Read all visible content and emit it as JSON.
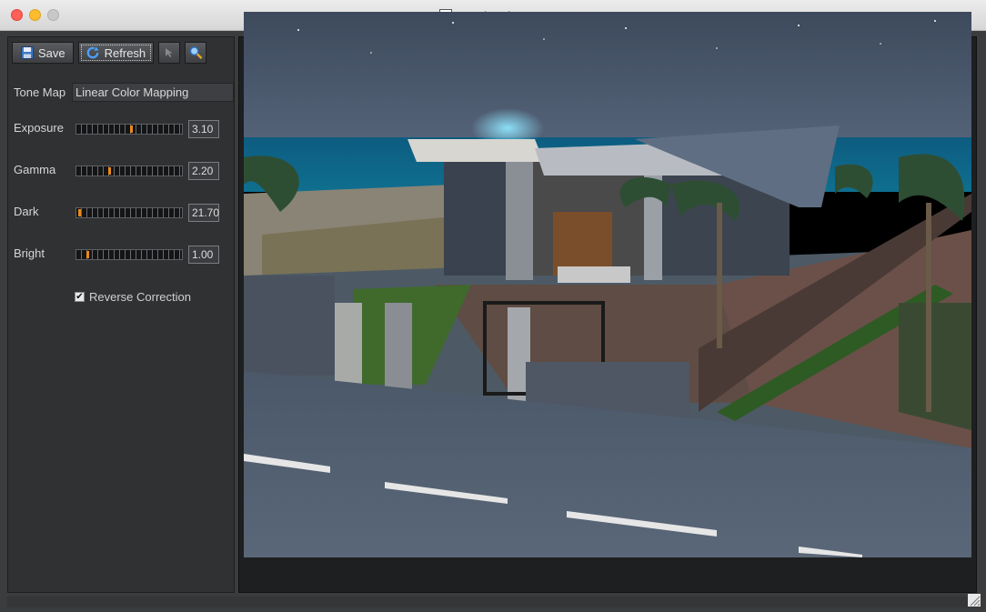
{
  "window": {
    "title": "Rendered Image"
  },
  "toolbar": {
    "save_label": "Save",
    "refresh_label": "Refresh"
  },
  "tone_map": {
    "label": "Tone Map",
    "value": "Linear Color Mapping"
  },
  "sliders": [
    {
      "label": "Exposure",
      "value": "3.10",
      "level": 0.52
    },
    {
      "label": "Gamma",
      "value": "2.20",
      "level": 0.3
    },
    {
      "label": "Dark",
      "value": "21.70",
      "level": 0.0
    },
    {
      "label": "Bright",
      "value": "1.00",
      "level": 0.08
    }
  ],
  "reverse_correction": {
    "label": "Reverse Correction",
    "checked": true
  },
  "colors": {
    "accent": "#e8891c",
    "panel": "#2f3133"
  }
}
